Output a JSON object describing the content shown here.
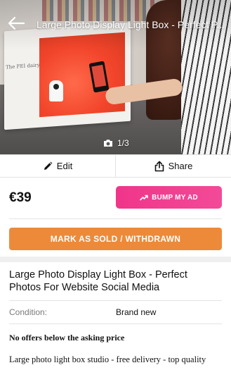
{
  "header": {
    "title": "Large Photo Display Light Box - Perfect P...",
    "back_icon": "arrow-left-icon",
    "photo_counter": "1/3",
    "camera_icon": "camera-icon"
  },
  "actions": {
    "edit_label": "Edit",
    "edit_icon": "pencil-icon",
    "share_label": "Share",
    "share_icon": "share-icon"
  },
  "listing": {
    "price": "€39",
    "bump_label": "BUMP MY AD",
    "bump_icon": "trending-up-icon",
    "sold_label": "MARK AS SOLD / WITHDRAWN",
    "title": "Large Photo Display Light Box - Perfect Photos For Website Social Media",
    "condition_label": "Condition:",
    "condition_value": "Brand new",
    "offers_note": "No offers below the asking price",
    "description": "Large photo light box studio - free delivery - top quality"
  },
  "photo": {
    "box_label": "The FEI dairy"
  },
  "colors": {
    "bump_pink": "#f0358a",
    "sold_orange": "#ec8a3a",
    "divider": "#e3e3e3"
  }
}
